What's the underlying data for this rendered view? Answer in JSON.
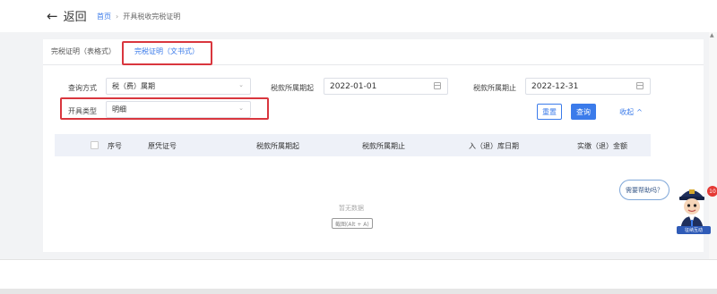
{
  "header": {
    "back_label": "返回",
    "breadcrumb": {
      "home": "首页",
      "current": "开具税收完税证明"
    }
  },
  "tabs": [
    {
      "label": "完税证明（表格式）"
    },
    {
      "label": "完税证明（文书式）"
    }
  ],
  "filters": {
    "query_method": {
      "label": "查询方式",
      "value": "税（费）属期"
    },
    "period_start": {
      "label": "税款所属期起",
      "value": "2022-01-01"
    },
    "period_end": {
      "label": "税款所属期止",
      "value": "2022-12-31"
    },
    "issue_type": {
      "label": "开具类型",
      "value": "明细"
    }
  },
  "actions": {
    "reset": "重置",
    "query": "查询",
    "collapse": "收起"
  },
  "table": {
    "columns": [
      "序号",
      "原凭证号",
      "税款所属期起",
      "税款所属期止",
      "入（退）库日期",
      "实缴（退）金额"
    ]
  },
  "empty_text": "暂无数据",
  "screenshot_tip": "截图(Alt + A)",
  "assistant": {
    "bubble": "需要帮助吗？",
    "badge": "10",
    "label": "征纳互动"
  },
  "colors": {
    "accent": "#3b7bea",
    "highlight": "#d9363e"
  }
}
